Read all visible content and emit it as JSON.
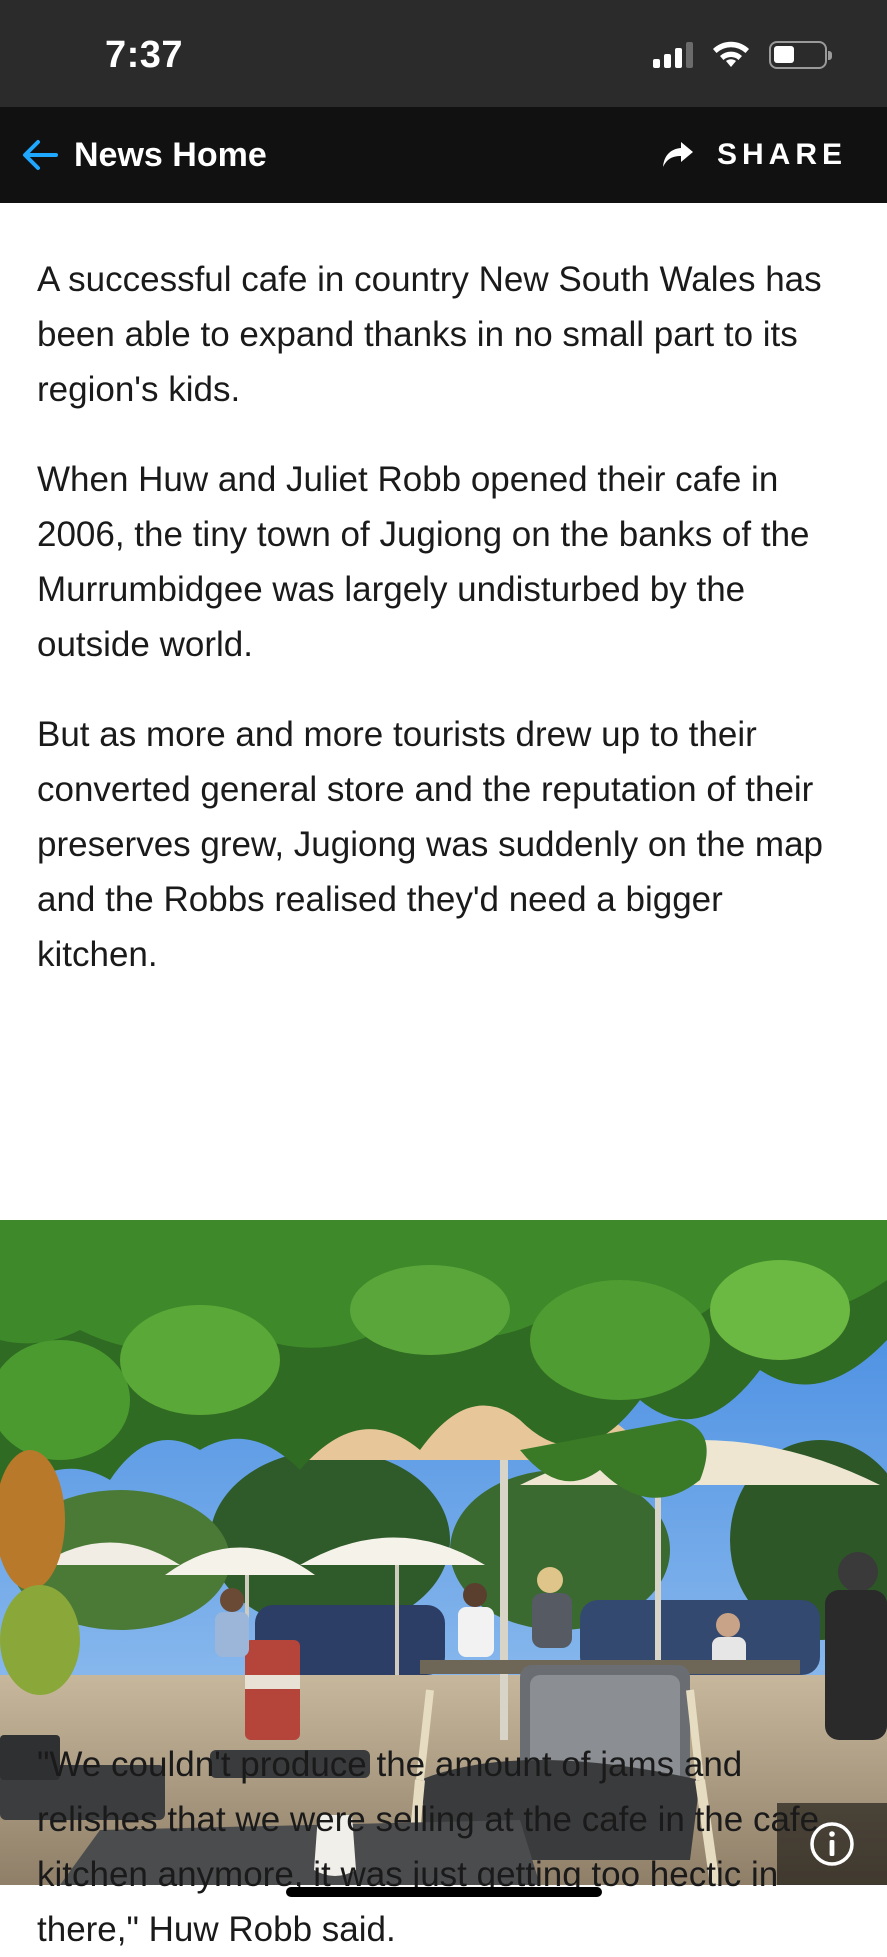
{
  "status_bar": {
    "time": "7:37"
  },
  "nav": {
    "back_label": "News Home",
    "share_label": "SHARE"
  },
  "article": {
    "paragraphs": [
      "A successful cafe in country New South Wales has been able to expand thanks in no small part to its region's kids.",
      "When Huw and Juliet Robb opened their cafe in 2006, the tiny town of Jugiong on the banks of the Murrumbidgee was largely undisturbed by the outside world.",
      "But as more and more tourists drew up to their converted general store and the reputation of their preserves grew, Jugiong was suddenly on the map and the Robbs realised they'd need a bigger kitchen.",
      "\"We couldn't produce the amount of jams and relishes that we were selling at the cafe in the cafe kitchen anymore, it was just getting too hectic in there,\" Huw Robb said."
    ]
  },
  "colors": {
    "status_bar_bg": "#2b2b2b",
    "nav_bg": "#111111",
    "accent": "#1ea8ff",
    "body_text": "#1a1a1a"
  },
  "icons": {
    "back": "arrow-left-icon",
    "share": "share-arrow-icon",
    "info": "info-icon",
    "wifi": "wifi-icon",
    "battery": "battery-icon",
    "signal": "signal-icon"
  }
}
